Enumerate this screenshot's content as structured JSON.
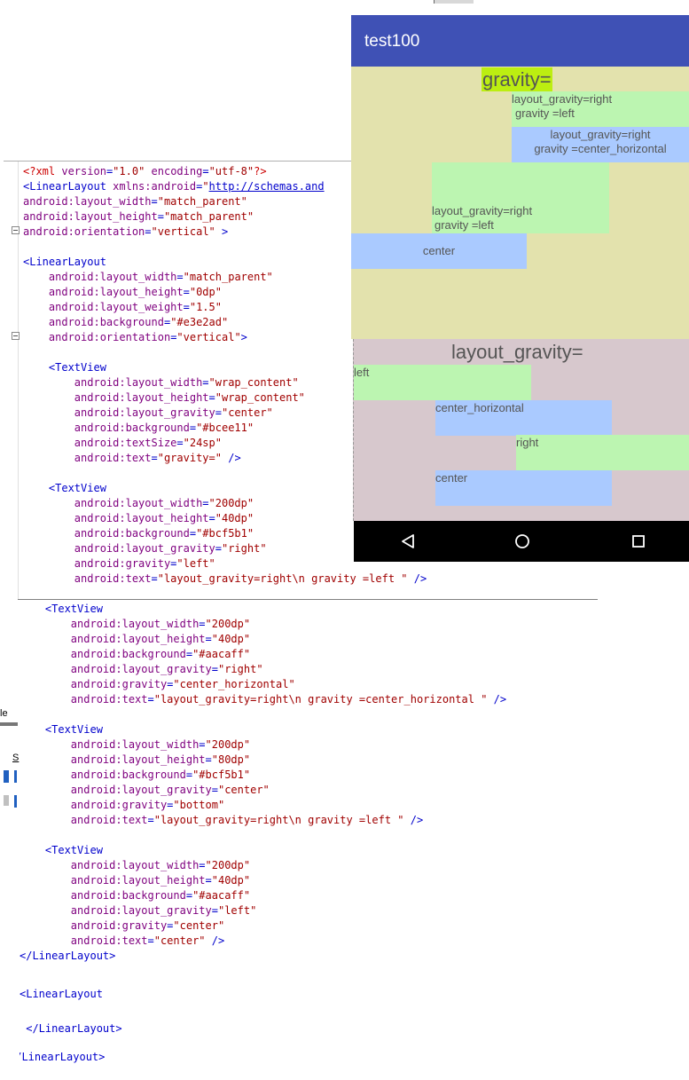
{
  "colors": {
    "appbar": "#3f51b5",
    "top_panel": "#e3e2ad",
    "bottom_panel": "#d7c8cd",
    "green": "#bcf5b1",
    "blue": "#aacaff",
    "lime": "#bcee11",
    "navbar": "#000000"
  },
  "app": {
    "title": "test100",
    "top": {
      "heading": "gravity=",
      "item1_line1": "layout_gravity=right",
      "item1_line2": "gravity =left",
      "item2_line1": "layout_gravity=right",
      "item2_line2": "gravity =center_horizontal",
      "item3_line1": "layout_gravity=right",
      "item3_line2": "gravity =left",
      "item4": "center"
    },
    "bottom": {
      "heading": "layout_gravity=",
      "left": "left",
      "center_horizontal": "center_horizontal",
      "right": "right",
      "center": "center"
    },
    "navbar": {
      "back_icon": "back-icon",
      "home_icon": "home-icon",
      "recents_icon": "recents-icon"
    }
  },
  "code_top": [
    "<?xml version=\"1.0\" encoding=\"utf-8\"?>",
    "<LinearLayout xmlns:android=\"http://schemas.and",
    "android:layout_width=\"match_parent\"",
    "android:layout_height=\"match_parent\"",
    "android:orientation=\"vertical\" >",
    "",
    "<LinearLayout",
    "    android:layout_width=\"match_parent\"",
    "    android:layout_height=\"0dp\"",
    "    android:layout_weight=\"1.5\"",
    "    android:background=\"#e3e2ad\"",
    "    android:orientation=\"vertical\">",
    "",
    "    <TextView",
    "        android:layout_width=\"wrap_content\"",
    "        android:layout_height=\"wrap_content\"",
    "        android:layout_gravity=\"center\"",
    "        android:background=\"#bcee11\"",
    "        android:textSize=\"24sp\"",
    "        android:text=\"gravity=\" />",
    "",
    "    <TextView",
    "        android:layout_width=\"200dp\"",
    "        android:layout_height=\"40dp\"",
    "        android:background=\"#bcf5b1\"",
    "        android:layout_gravity=\"right\"",
    "        android:gravity=\"left\"",
    "        android:text=\"layout_gravity=right\\n gravity =left \" />"
  ],
  "code_bottom": [
    "    <TextView",
    "        android:layout_width=\"200dp\"",
    "        android:layout_height=\"40dp\"",
    "        android:background=\"#aacaff\"",
    "        android:layout_gravity=\"right\"",
    "        android:gravity=\"center_horizontal\"",
    "        android:text=\"layout_gravity=right\\n gravity =center_horizontal \" />",
    "",
    "    <TextView",
    "        android:layout_width=\"200dp\"",
    "        android:layout_height=\"80dp\"",
    "        android:background=\"#bcf5b1\"",
    "        android:layout_gravity=\"center\"",
    "        android:gravity=\"bottom\"",
    "        android:text=\"layout_gravity=right\\n gravity =left \" />",
    "",
    "    <TextView",
    "        android:layout_width=\"200dp\"",
    "        android:layout_height=\"40dp\"",
    "        android:background=\"#aacaff\"",
    "        android:layout_gravity=\"left\"",
    "        android:gravity=\"center\"",
    "        android:text=\"center\" />",
    "</LinearLayout>",
    "",
    "",
    "<LinearLayout",
    "",
    "",
    " </LinearLayout>",
    "",
    "</LinearLayout>"
  ],
  "side_fragment": {
    "label": "le",
    "letter": "S"
  }
}
